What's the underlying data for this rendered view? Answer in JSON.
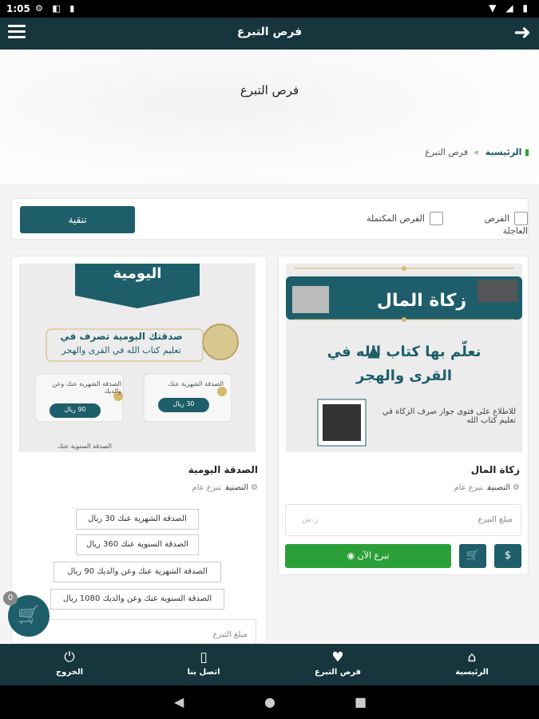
{
  "status": {
    "time": "1:05"
  },
  "appbar": {
    "title": "فرص التبرع"
  },
  "hero": {
    "title": "فرص التبرع"
  },
  "breadcrumb": {
    "home": "الرئيسية",
    "separator": "»",
    "current": "فرص التبرع"
  },
  "filter": {
    "urgent_label": "الفرص العاجلة",
    "completed_label": "الفرص المكتملة",
    "apply_label": "تنقية"
  },
  "card1": {
    "banner": "زكاة المال",
    "headline_line1": "نعلّم بها كتاب الله في",
    "headline_line2": "القرى والهجر",
    "side_text": "للاطلاع على فتوى جواز صرف الزكاة في تعليم كتاب الله",
    "title": "زكاة المال",
    "category_label": "التصنيف",
    "category_value": "تبرع عام",
    "amount_placeholder": "مبلغ التبرع",
    "amount_currency": "ر.س",
    "donate_label": "تبرع الآن"
  },
  "card2": {
    "banner": "اليومية",
    "headline_line1": "صدقتك اليومية تصرف في",
    "headline_line2": "تعليم كتاب الله في القرى والهجر",
    "promo_monthly": "الصدقة الشهرية عنك",
    "promo_monthly_family": "الصدقة الشهرية عنك وعن والديك",
    "promo_yearly": "الصدقة السنوية عنك",
    "promo_price_30": "30 ريال",
    "promo_price_90": "90 ريال",
    "title": "الصدقة اليومية",
    "category_label": "التصنيف",
    "category_value": "تبرع عام",
    "options": [
      "الصدقة الشهرية عنك 30 ريال",
      "الصدقة السنوية عنك 360 ريال",
      "الصدقة الشهرية عنك وعن والديك 90 ريال",
      "الصدقة السنوية عنك وعن والديك 1080 ريال"
    ],
    "amount_placeholder": "مبلغ التبرع"
  },
  "cart": {
    "count": "0"
  },
  "bottom_nav": [
    {
      "label": "الرئيسية",
      "icon": "home-icon"
    },
    {
      "label": "فرص التبرع",
      "icon": "heart-icon"
    },
    {
      "label": "اتصل بنا",
      "icon": "phone-icon"
    },
    {
      "label": "الخروج",
      "icon": "power-icon"
    }
  ],
  "colors": {
    "primary_dark": "#16353c",
    "teal": "#1e5e6a",
    "green": "#2ba038"
  }
}
